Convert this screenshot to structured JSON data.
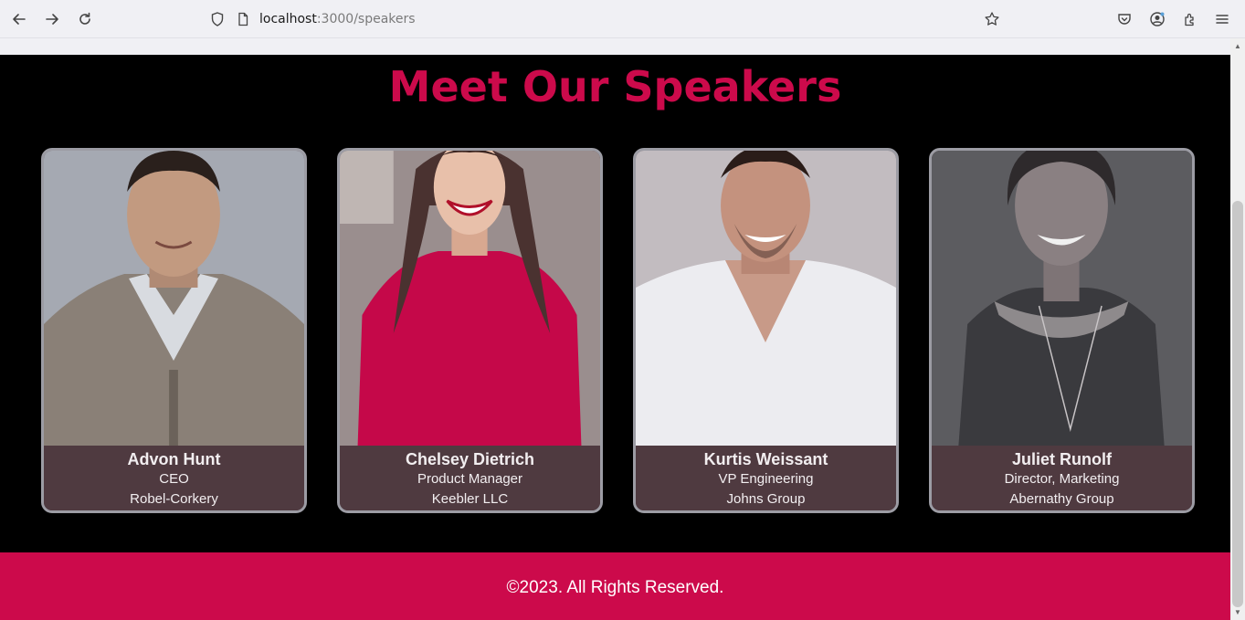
{
  "browser": {
    "url_host": "localhost",
    "url_path": ":3000/speakers"
  },
  "page": {
    "heading": "Meet Our Speakers",
    "speakers": [
      {
        "name": "Advon Hunt",
        "title": "CEO",
        "company": "Robel-Corkery"
      },
      {
        "name": "Chelsey Dietrich",
        "title": "Product Manager",
        "company": "Keebler LLC"
      },
      {
        "name": "Kurtis Weissant",
        "title": "VP Engineering",
        "company": "Johns Group"
      },
      {
        "name": "Juliet Runolf",
        "title": "Director, Marketing",
        "company": "Abernathy Group"
      }
    ],
    "footer": "©2023. All Rights Reserved."
  },
  "colors": {
    "accent": "#cc0a4b",
    "card_info_bg": "#4f3a40",
    "page_bg": "#000000"
  }
}
